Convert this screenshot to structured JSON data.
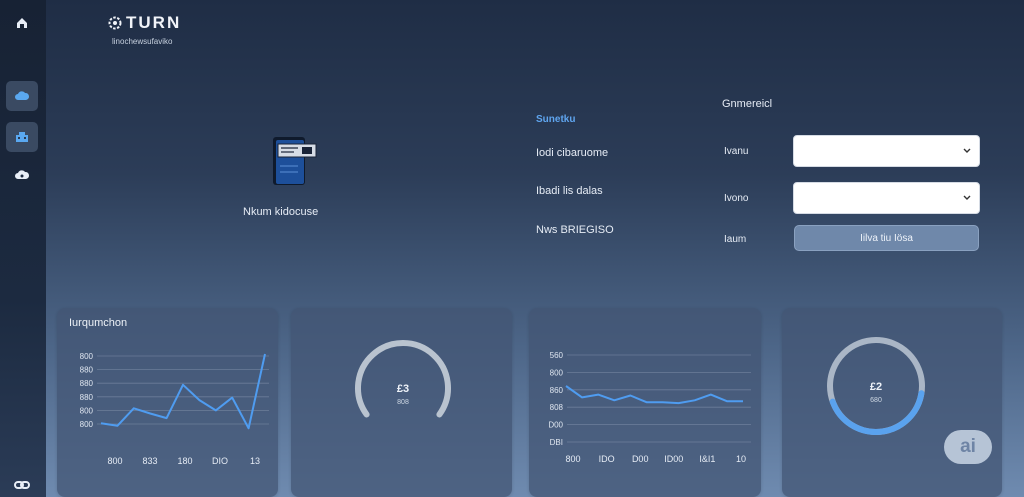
{
  "brand": {
    "title": "TURN",
    "subtitle": "linochewsufaviko"
  },
  "sidebar": {
    "items": [
      {
        "name": "home-icon"
      },
      {
        "name": "cloud-icon",
        "active": true
      },
      {
        "name": "building-icon",
        "active": true
      },
      {
        "name": "cloud-upload-icon"
      }
    ],
    "bottom": {
      "name": "link-icon"
    }
  },
  "document": {
    "icon": "document-stack-icon",
    "label": "Nkum kidocuse"
  },
  "form": {
    "section_title": "Sunetku",
    "left_labels": [
      "Iodi cibaruome",
      "Ibadi lis dalas",
      "Nws BRIEGISO"
    ],
    "right_header": "Gnmereicl",
    "fields": [
      {
        "label": "Ivanu",
        "value": ""
      },
      {
        "label": "Ivono",
        "value": ""
      }
    ],
    "button_field_label": "Iaum",
    "button_label": "Iilva tiu Iösa"
  },
  "cards": [
    {
      "title": "Iurqumchon"
    },
    {
      "title": ""
    },
    {
      "title": ""
    },
    {
      "title": ""
    }
  ],
  "chart_data": [
    {
      "type": "line",
      "title": "Iurqumchon",
      "categories": [
        "800",
        "833",
        "180",
        "DIO",
        "13"
      ],
      "y_tick_labels": [
        "800",
        "880",
        "880",
        "880",
        "800",
        "800"
      ],
      "x": [
        0,
        0.5,
        1,
        1.5,
        2,
        2.5,
        3,
        3.5,
        4,
        4.5,
        5
      ],
      "values": [
        50,
        40,
        108,
        88,
        70,
        200,
        140,
        100,
        150,
        30,
        320
      ],
      "grid": true,
      "color": "#4f9cf0"
    },
    {
      "type": "gauge",
      "value_label": "£3",
      "sub_label": "808",
      "fraction": 1.0,
      "color": "#b9c3cf"
    },
    {
      "type": "line",
      "categories": [
        "800",
        "IDO",
        "D00",
        "ID00",
        "I&I1",
        "10"
      ],
      "y_tick_labels": [
        "560",
        "800",
        "860",
        "808",
        "D00",
        "DBI"
      ],
      "values": [
        42,
        30,
        33,
        27,
        32,
        25,
        25,
        24,
        27,
        33,
        26,
        26
      ],
      "grid": true,
      "color": "#4f9cf0"
    },
    {
      "type": "gauge",
      "value_label": "£2",
      "sub_label": "680",
      "fraction": 0.35,
      "color": "#5aa2ee"
    }
  ],
  "ai_badge": "ai"
}
